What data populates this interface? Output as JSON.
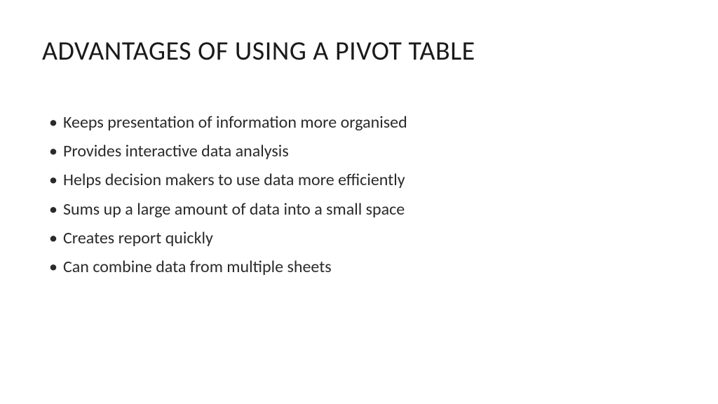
{
  "slide": {
    "title": "ADVANTAGES OF USING A PIVOT TABLE",
    "bullets": [
      "Keeps presentation of information more organised",
      "Provides interactive data analysis",
      "Helps decision makers to use data more efficiently",
      "Sums up a large amount of data into a small space",
      "Creates report quickly",
      "Can combine data from multiple sheets"
    ]
  }
}
